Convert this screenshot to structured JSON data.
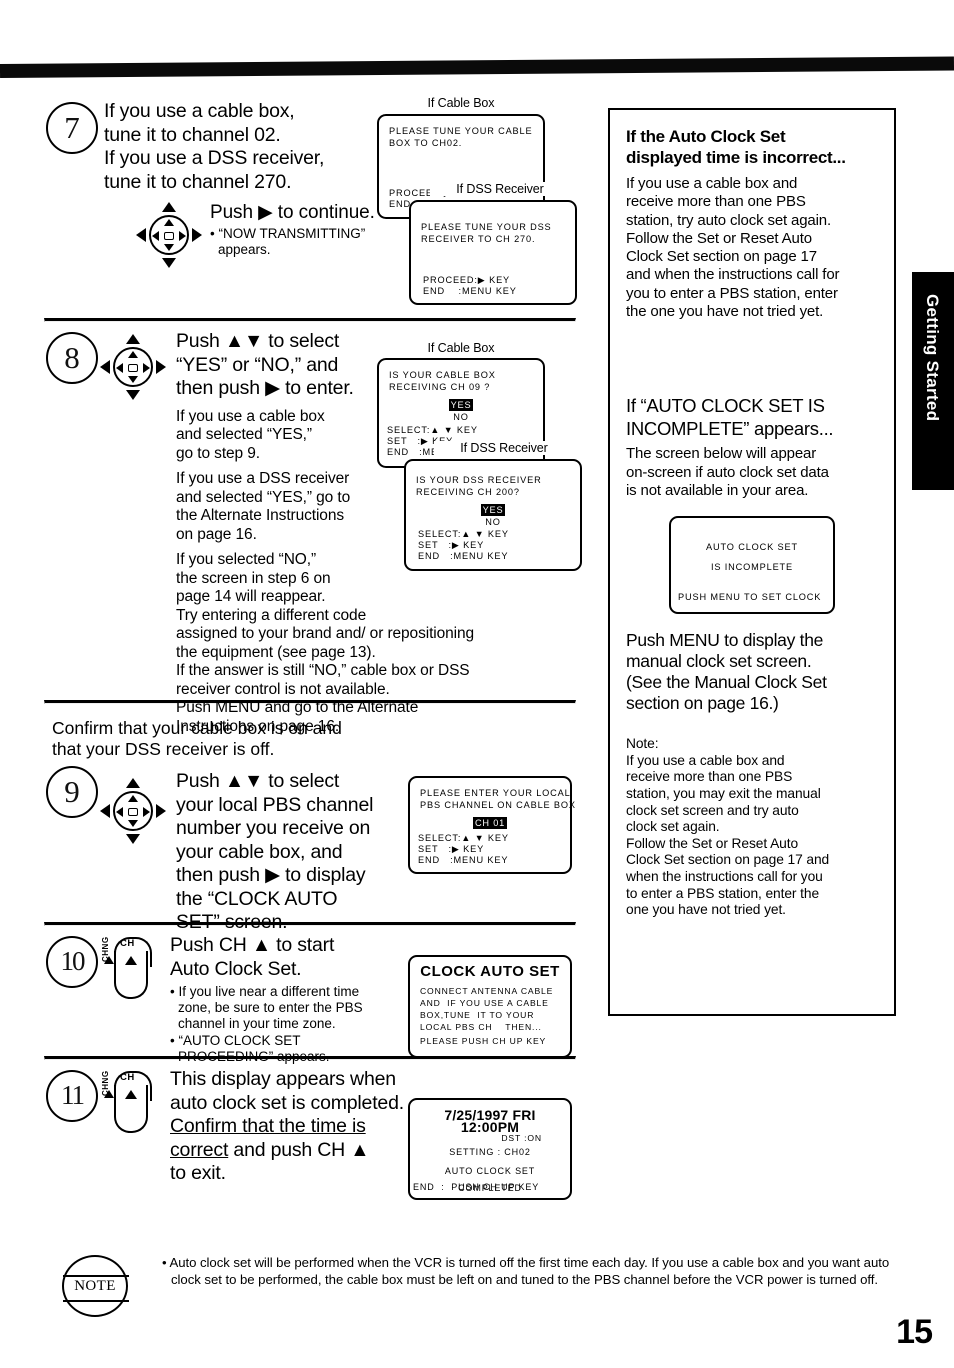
{
  "page": {
    "number": "15",
    "side_tab": "Getting Started"
  },
  "steps": [
    {
      "id": "7",
      "number": "7",
      "lead": "If you use a cable box,\ntune it to channel 02.\nIf you use a DSS receiver,\ntune it to channel 270.",
      "action": "Push ▶ to continue.",
      "bullets": [
        "• “NOW TRANSMITTING”\n  appears."
      ],
      "icon": "dpad-icon",
      "screens": [
        {
          "caption": "If Cable Box",
          "lines": [
            "PLEASE TUNE YOUR CABLE",
            "BOX TO CH02."
          ],
          "footer": [
            "PROCEED:▶ KEY",
            "END    :MENU KEY"
          ]
        },
        {
          "caption": "If DSS Receiver",
          "lines": [
            "PLEASE TUNE YOUR DSS",
            "RECEIVER TO CH 270."
          ],
          "footer": [
            "PROCEED:▶ KEY",
            "END    :MENU KEY"
          ]
        }
      ]
    },
    {
      "id": "8",
      "number": "8",
      "lead": "Push ▲▼ to select\n“YES” or “NO,” and\nthen push ▶ to enter.",
      "paragraphs": [
        "If you use a cable box\nand selected “YES,”\ngo to step 9.",
        "If you use a DSS receiver\nand selected “YES,” go to\nthe Alternate Instructions\non page 16.",
        "If you selected “NO,”\nthe screen in step 6 on\npage 14 will reappear.\nTry entering a different code\nassigned to your brand and/ or repositioning\nthe equipment (see page 13).\nIf the answer is still “NO,” cable box or DSS\nreceiver control is not available.\nPush MENU and go to the Alternate\nInstructions on page 16."
      ],
      "icon": "dpad-icon",
      "screens": [
        {
          "caption": "If Cable Box",
          "lines": [
            "IS YOUR CABLE BOX",
            "RECEIVING CH 09 ?"
          ],
          "choice_selected": "YES",
          "choice_other": "NO",
          "footer": [
            "SELECT:▲ ▼ KEY",
            "SET   :▶ KEY",
            "END   :MENU KEY"
          ]
        },
        {
          "caption": "If DSS Receiver",
          "lines": [
            "IS YOUR DSS RECEIVER",
            "RECEIVING CH 200?"
          ],
          "choice_selected": "YES",
          "choice_other": "NO",
          "footer": [
            "SELECT:▲ ▼ KEY",
            "SET   :▶ KEY",
            "END   :MENU KEY"
          ]
        }
      ]
    },
    {
      "id": "9",
      "number": "9",
      "preamble": "Confirm that your cable box is on and\nthat your DSS receiver is off.",
      "lead": "Push ▲▼ to select\nyour local PBS channel\nnumber you receive on\nyour cable box, and\nthen push ▶ to display\nthe “CLOCK AUTO\nSET” screen.",
      "icon": "dpad-icon",
      "screen": {
        "lines": [
          "PLEASE ENTER YOUR LOCAL",
          "PBS CHANNEL ON CABLE BOX"
        ],
        "highlight": "CH 01",
        "footer": [
          "SELECT:▲ ▼ KEY",
          "SET   :▶ KEY",
          "END   :MENU KEY"
        ]
      }
    },
    {
      "id": "10",
      "number": "10",
      "lead": "Push CH ▲ to start\nAuto Clock Set.",
      "bullets": [
        "• If you live near a different time\n  zone, be sure to enter the PBS\n  channel in your time zone.",
        "• “AUTO CLOCK SET\n  PROCEEDING” appears."
      ],
      "icon": "ch-rocker-icon",
      "icon_label": "CH",
      "icon_sub": "CHNG",
      "screen": {
        "title": "CLOCK AUTO SET",
        "lines": [
          "CONNECT ANTENNA CABLE",
          "AND  IF YOU USE A CABLE",
          "BOX,TUNE  IT TO YOUR",
          "LOCAL PBS CH    THEN..."
        ],
        "footer": [
          "PLEASE PUSH CH UP KEY"
        ]
      }
    },
    {
      "id": "11",
      "number": "11",
      "lead_pre": "This display appears when\nauto clock set is completed.\n",
      "lead_underline": "Confirm that the time is\ncorrect",
      "lead_post": " and push CH ▲\nto exit.",
      "icon": "ch-rocker-icon",
      "icon_label": "CH",
      "icon_sub": "CHNG",
      "screen": {
        "header": "7/25/1997 FRI 12:00PM",
        "dst": "DST :ON",
        "setting": "SETTING : CH02",
        "lines": [
          "AUTO CLOCK SET",
          "COMPLETED"
        ],
        "footer": [
          "END  :  PUSH CH UP KEY"
        ]
      }
    }
  ],
  "right_panel": {
    "section1": {
      "heading": "If the Auto Clock Set\ndisplayed time is incorrect...",
      "body": "If you use a cable box and\nreceive more than one PBS\nstation, try auto clock set again.\nFollow the Set or Reset Auto\nClock Set section on page 17\nand when the instructions call for\nyou to enter a PBS station, enter\nthe one you have not tried yet."
    },
    "section2": {
      "heading": "If “AUTO CLOCK SET IS\nINCOMPLETE” appears...",
      "body": "The screen below will appear\non-screen if auto clock set data\nis not available in your area.",
      "screen": {
        "lines": [
          "AUTO CLOCK SET",
          "IS INCOMPLETE"
        ],
        "footer": [
          "PUSH MENU TO SET CLOCK"
        ]
      },
      "after": "Push MENU to display the\nmanual clock set screen.\n(See the Manual Clock Set\nsection on page 16.)",
      "note_label": "Note:",
      "note_body": "If you use a cable box and\nreceive more than one PBS\nstation, you may exit the manual\nclock set screen and try auto\nclock set again.\nFollow the Set or Reset Auto\nClock Set section on page 17 and\nwhen the instructions call for you\nto enter a PBS station, enter the\none you have not tried yet."
    }
  },
  "note_footer": {
    "badge": "NOTE",
    "text": "• Auto clock set will be performed when the VCR is turned off the first time each day. If you use a cable box and you want auto clock set to be performed, the cable box must be left on and tuned to the PBS channel before the VCR power is turned off."
  }
}
